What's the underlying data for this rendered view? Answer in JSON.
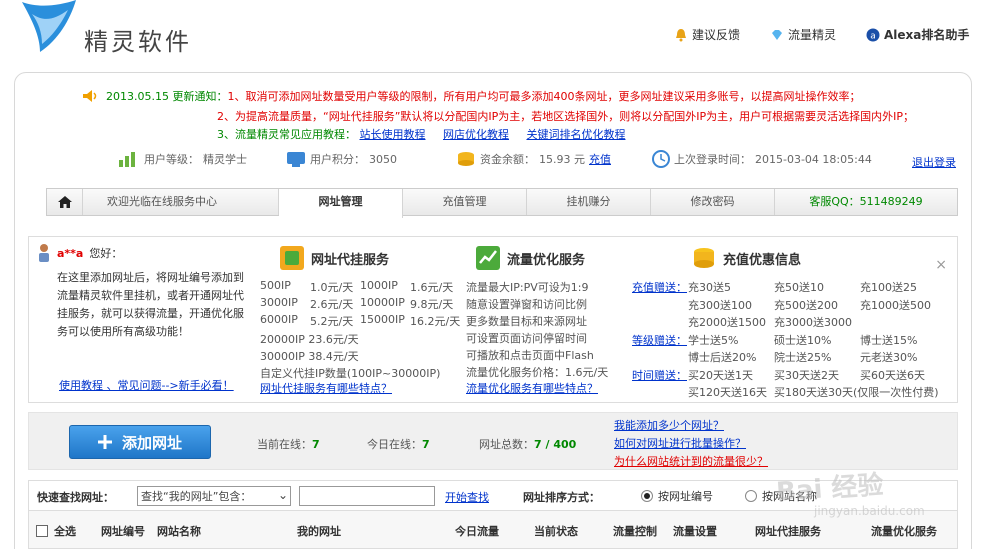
{
  "colors": {
    "accent_blue": "#1f76c8",
    "notice_red": "#e00000",
    "notice_green": "#008800",
    "link_blue": "#0033cc"
  },
  "header": {
    "logo_icon": "bird-logo-icon",
    "title": "精灵软件",
    "links": [
      {
        "label": "建议反馈",
        "icon": "bell-icon"
      },
      {
        "label": "流量精灵",
        "icon": "diamond-icon"
      },
      {
        "label": "Alexa排名助手",
        "icon": "alexa-icon"
      }
    ]
  },
  "notice": {
    "date": "2013.05.15 更新通知：",
    "line1": "1、取消可添加网址数量受用户等级的限制，所有用户均可最多添加400条网址，更多网址建议采用多账号，以提高网址操作效率；",
    "line2": "2、为提高流量质量，“网址代挂服务”默认将以分配国内IP为主，若地区选择国外，则将以分配国外IP为主，用户可根据需要灵活选择国内外IP；",
    "line3_prefix": "3、流量精灵常见应用教程：",
    "line3_links": [
      "站长使用教程",
      "网店优化教程",
      "关键词排名优化教程"
    ]
  },
  "user_info": {
    "level_label": "用户等级：",
    "level_value": "精灵学士",
    "points_label": "用户积分：",
    "points_value": "3050",
    "balance_label": "资金余额：",
    "balance_value": "15.93 元",
    "recharge": "充值",
    "last_login_label": "上次登录时间：",
    "last_login_value": "2015-03-04 18:05:44",
    "logout": "退出登录"
  },
  "tabs": {
    "welcome": "欢迎光临在线服务中心",
    "items": [
      "网址管理",
      "充值管理",
      "挂机赚分",
      "修改密码"
    ],
    "qq": "客服QQ：511489249"
  },
  "welcome": {
    "name": "a**a",
    "greet": "您好：",
    "body": "在这里添加网址后，将网址编号添加到流量精灵软件里挂机，或者开通网址代挂服务，就可以获得流量，开通优化服务可以使用所有高级功能！",
    "link": "使用教程 、常见问题-->新手必看！"
  },
  "service1": {
    "title": "网址代挂服务",
    "prices": [
      [
        "500IP",
        "1.0元/天",
        "1000IP",
        "1.6元/天"
      ],
      [
        "3000IP",
        "2.6元/天",
        "10000IP",
        "9.8元/天"
      ],
      [
        "6000IP",
        "5.2元/天",
        "15000IP",
        "16.2元/天"
      ]
    ],
    "extra": [
      "20000IP 23.6元/天",
      "30000IP 38.4元/天",
      "自定义代挂IP数量(100IP~30000IP)"
    ],
    "link": "网址代挂服务有哪些特点？"
  },
  "service2": {
    "title": "流量优化服务",
    "lines": [
      "流量最大IP:PV可设为1:9",
      "随意设置弹窗和访问比例",
      "更多数量目标和来源网址",
      "可设置页面访问停留时间",
      "可播放和点击页面中Flash",
      "流量优化服务价格：1.6元/天"
    ],
    "link": "流量优化服务有哪些特点？"
  },
  "promo": {
    "title": "充值优惠信息",
    "rows": [
      {
        "label": "充值赠送：",
        "cells": [
          "充30送5",
          "充50送10",
          "充100送25"
        ]
      },
      {
        "label": "",
        "cells": [
          "充300送100",
          "充500送200",
          "充1000送500"
        ]
      },
      {
        "label": "",
        "cells": [
          "充2000送1500",
          "充3000送3000",
          ""
        ]
      },
      {
        "label": "等级赠送：",
        "cells": [
          "学士送5%",
          "硕士送10%",
          "博士送15%"
        ]
      },
      {
        "label": "",
        "cells": [
          "博士后送20%",
          "院士送25%",
          "元老送30%"
        ]
      },
      {
        "label": "时间赠送：",
        "cells": [
          "买20天送1天",
          "买30天送2天",
          "买60天送6天"
        ]
      },
      {
        "label": "",
        "cells": [
          "买120天送16天",
          "买180天送30天(仅限一次性付费)",
          ""
        ]
      }
    ],
    "close": "×"
  },
  "toolbar": {
    "add_label": "添加网址",
    "online_label": "当前在线：",
    "online_value": "7",
    "today_label": "今日在线：",
    "today_value": "7",
    "total_label": "网址总数：",
    "total_value": "7 / 400",
    "faq": [
      "我能添加多少个网址？",
      "如何对网址进行批量操作？",
      "为什么网站统计到的流量很少？"
    ]
  },
  "search": {
    "label": "快速查找网址：",
    "select_value": "查找“我的网址”包含：",
    "input_value": "",
    "go": "开始查找",
    "sort_label": "网址排序方式：",
    "radio1": "按网址编号",
    "radio2": "按网站名称"
  },
  "table": {
    "headers": [
      "全选",
      "网址编号",
      "网站名称",
      "我的网址",
      "今日流量",
      "当前状态",
      "流量控制",
      "流量设置",
      "网址代挂服务",
      "流量优化服务"
    ]
  },
  "watermark": {
    "text": "Bai 经验",
    "sub": "jingyan.baidu.com"
  }
}
